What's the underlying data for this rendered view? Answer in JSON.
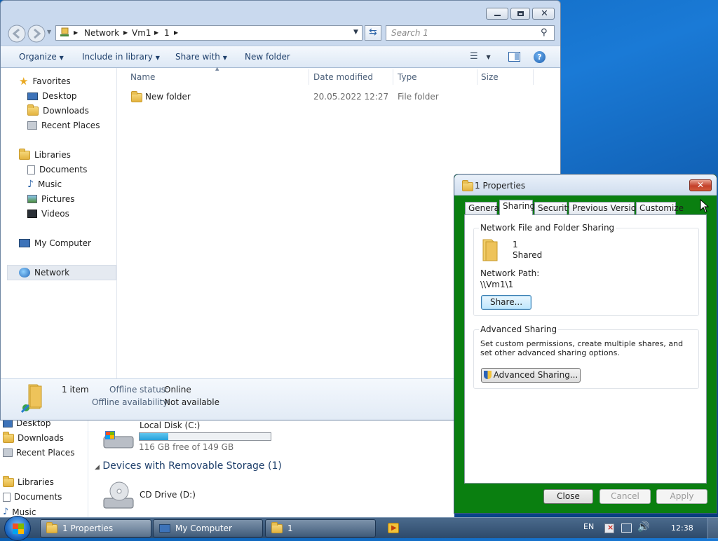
{
  "background_window": {
    "sidebar": [
      "Desktop",
      "Downloads",
      "Recent Places",
      "Libraries",
      "Documents",
      "Music"
    ],
    "local_disk": {
      "name": "Local Disk (C:)",
      "free": "116 GB free of 149 GB",
      "used_fraction": 0.22
    },
    "removable_header": "Devices with Removable Storage (1)",
    "cd_drive": "CD Drive (D:)"
  },
  "explorer": {
    "breadcrumb": [
      "Network",
      "Vm1",
      "1"
    ],
    "search_placeholder": "Search 1",
    "toolbar": {
      "organize": "Organize",
      "include_in_library": "Include in library",
      "share_with": "Share with",
      "new_folder": "New folder"
    },
    "sidebar": {
      "favorites": "Favorites",
      "favorites_items": [
        "Desktop",
        "Downloads",
        "Recent Places"
      ],
      "libraries": "Libraries",
      "libraries_items": [
        "Documents",
        "Music",
        "Pictures",
        "Videos"
      ],
      "my_computer": "My Computer",
      "network": "Network"
    },
    "columns": {
      "name": "Name",
      "date_modified": "Date modified",
      "type": "Type",
      "size": "Size"
    },
    "files": [
      {
        "name": "New folder",
        "date_modified": "20.05.2022 12:27",
        "type": "File folder",
        "size": ""
      }
    ],
    "details": {
      "count": "1 item",
      "offline_status_label": "Offline status:",
      "offline_status_value": "Online",
      "offline_availability_label": "Offline availability:",
      "offline_availability_value": "Not available"
    }
  },
  "dialog": {
    "title": "1 Properties",
    "tabs": [
      "General",
      "Sharing",
      "Security",
      "Previous Versions",
      "Customize"
    ],
    "active_tab": "Sharing",
    "network_sharing": {
      "group_label": "Network File and Folder Sharing",
      "folder_name": "1",
      "status": "Shared",
      "network_path_label": "Network Path:",
      "network_path_value": "\\\\Vm1\\1",
      "share_button": "Share..."
    },
    "advanced_sharing": {
      "group_label": "Advanced Sharing",
      "description": "Set custom permissions, create multiple shares, and set other advanced sharing options.",
      "button": "Advanced Sharing..."
    },
    "buttons": {
      "close": "Close",
      "cancel": "Cancel",
      "apply": "Apply"
    }
  },
  "taskbar": {
    "items": [
      "1 Properties",
      "My Computer",
      "1"
    ],
    "language": "EN",
    "time": "12:38"
  },
  "colors": {
    "dialog_frame": "#0a7f10",
    "accent": "#1c69c4"
  }
}
